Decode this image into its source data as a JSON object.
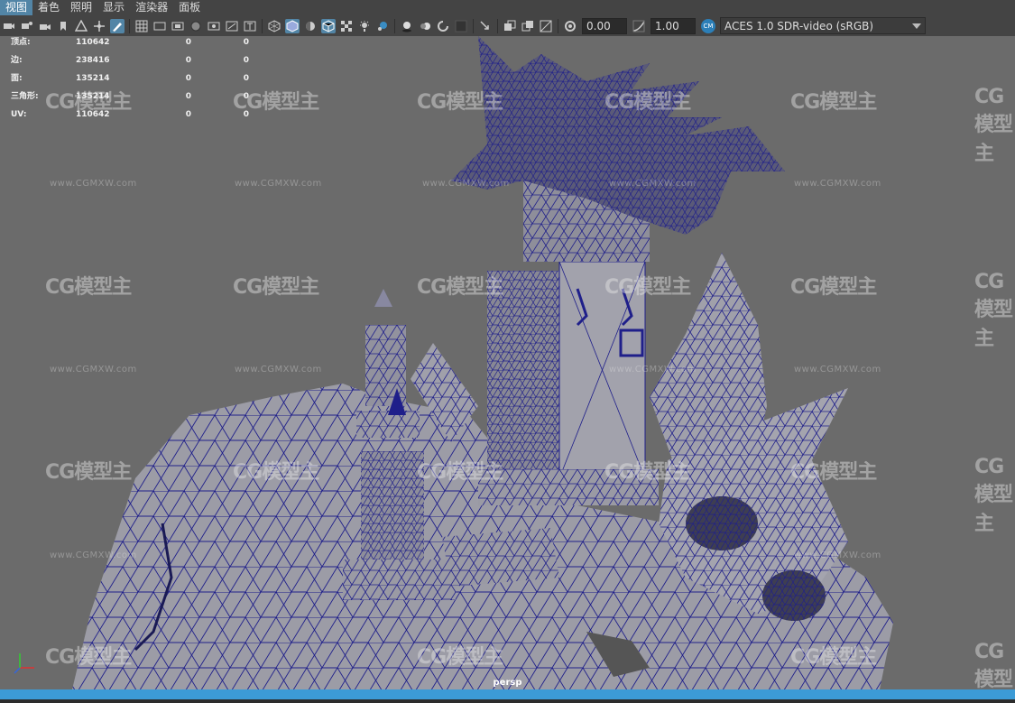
{
  "menu": [
    "视图",
    "着色",
    "照明",
    "显示",
    "渲染器",
    "面板"
  ],
  "toolbar": {
    "exposure": "0.00",
    "gamma": "1.00",
    "colorspace_badge": "CM",
    "colorspace": "ACES 1.0 SDR-video (sRGB)"
  },
  "hud": {
    "rows": [
      {
        "label": "顶点:",
        "v1": "110642",
        "v2": "0",
        "v3": "0"
      },
      {
        "label": "边:",
        "v1": "238416",
        "v2": "0",
        "v3": "0"
      },
      {
        "label": "面:",
        "v1": "135214",
        "v2": "0",
        "v3": "0"
      },
      {
        "label": "三角形:",
        "v1": "135214",
        "v2": "0",
        "v3": "0"
      },
      {
        "label": "UV:",
        "v1": "110642",
        "v2": "0",
        "v3": "0"
      }
    ]
  },
  "camera_label": "persp",
  "watermark": {
    "logo": "CG模型主",
    "url": "www.CGMXW.com"
  },
  "icons": [
    "select-camera-icon",
    "camera-attr-icon",
    "bookmark-icon",
    "grid-icon",
    "film-gate-icon",
    "resolution-gate-icon",
    "gate-mask-icon",
    "field-chart-icon",
    "safe-action-icon",
    "safe-title-icon",
    "wireframe-icon",
    "smooth-shade-icon",
    "default-material-icon",
    "textured-icon",
    "lights-icon",
    "shadows-icon",
    "screen-ambient-icon",
    "motion-blur-icon",
    "anti-alias-icon",
    "isolate-icon",
    "xray-icon",
    "xray-joints-icon",
    "backface-icon",
    "exposure-icon",
    "gamma-icon",
    "colorspace-icon"
  ],
  "colors": {
    "selected": "#5285a6",
    "wire": "#1f1f8a",
    "viewport": "#6b6b6b",
    "timeline": "#3c9bd6"
  }
}
